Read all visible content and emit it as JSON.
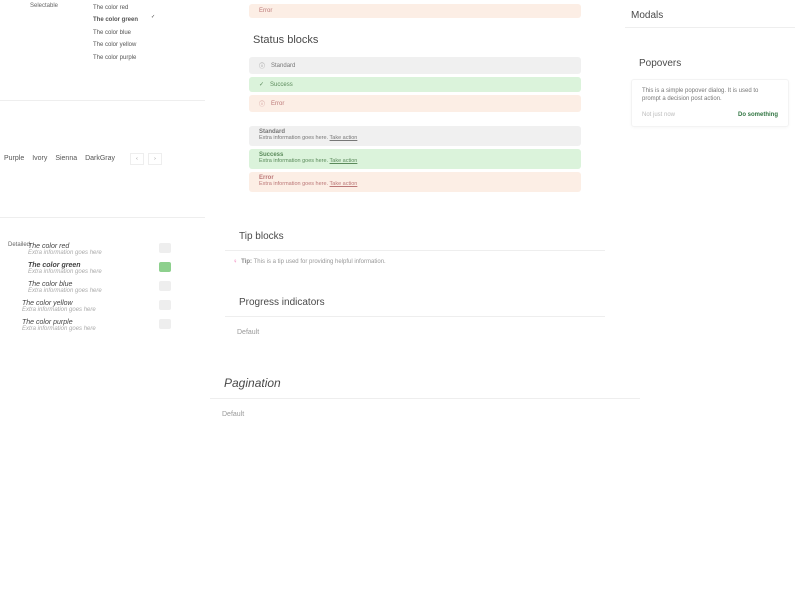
{
  "left": {
    "selectable_label": "Selectable",
    "items": [
      {
        "label": "The color red",
        "selected": false
      },
      {
        "label": "The color green",
        "selected": true
      },
      {
        "label": "The color blue",
        "selected": false
      },
      {
        "label": "The color yellow",
        "selected": false
      },
      {
        "label": "The color purple",
        "selected": false
      }
    ],
    "tabs": [
      "Purple",
      "Ivory",
      "Sienna",
      "DarkGray"
    ],
    "detailed_label": "Detailed",
    "detailed": [
      {
        "name": "The color red",
        "extra": "Extra information goes here",
        "sel": false
      },
      {
        "name": "The color green",
        "extra": "Extra information goes here",
        "sel": true
      },
      {
        "name": "The color blue",
        "extra": "Extra information goes here",
        "sel": false
      },
      {
        "name": "The color yellow",
        "extra": "Extra information goes here",
        "sel": false
      },
      {
        "name": "The color purple",
        "extra": "Extra information goes here",
        "sel": false
      }
    ]
  },
  "mid": {
    "top_error": "Error",
    "status_h": "Status blocks",
    "simple": [
      {
        "kind": "std",
        "label": "Standard",
        "icon": "ⓘ"
      },
      {
        "kind": "suc",
        "label": "Success",
        "icon": "✓"
      },
      {
        "kind": "err",
        "label": "Error",
        "icon": "ⓘ"
      }
    ],
    "detail": [
      {
        "kind": "std",
        "title": "Standard",
        "body": "Extra information goes here.",
        "action": "Take action"
      },
      {
        "kind": "suc",
        "title": "Success",
        "body": "Extra information goes here.",
        "action": "Take action"
      },
      {
        "kind": "err",
        "title": "Error",
        "body": "Extra information goes here.",
        "action": "Take action"
      }
    ],
    "tip_h": "Tip blocks",
    "tip_label": "Tip:",
    "tip_body": "This is a tip used for providing helpful information.",
    "prog_h": "Progress indicators",
    "prog_default": "Default",
    "pag_h": "Pagination",
    "pag_default": "Default"
  },
  "right": {
    "modals_h": "Modals",
    "popovers_h": "Popovers",
    "pop_body": "This is a simple popover dialog. It is used to prompt a decision post action.",
    "pop_cancel": "Not just now",
    "pop_do": "Do something"
  }
}
